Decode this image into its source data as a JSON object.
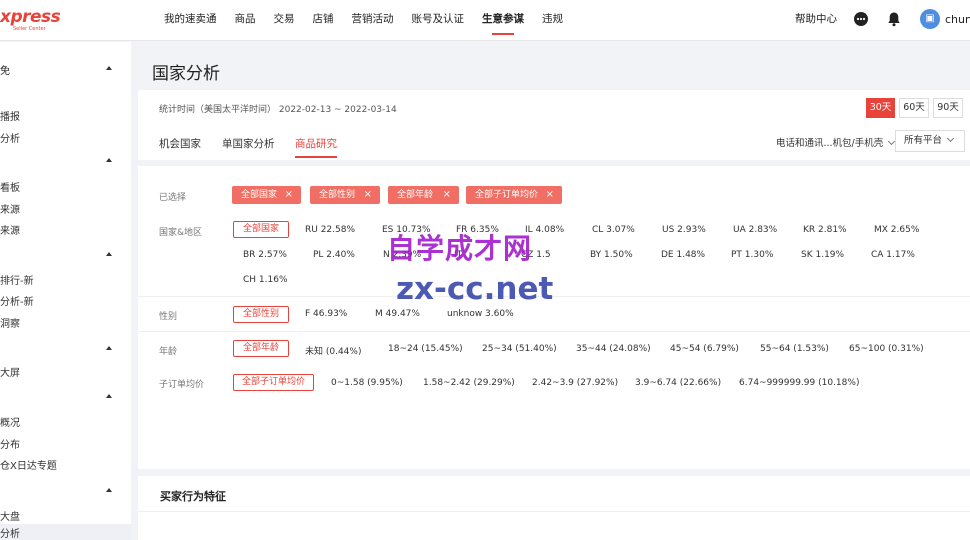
{
  "header": {
    "logo_main": "xpress",
    "logo_sub": "Seller Center",
    "nav": [
      "我的速卖通",
      "商品",
      "交易",
      "店铺",
      "营销活动",
      "账号及认证",
      "生意参谋",
      "违规"
    ],
    "active_nav": "生意参谋",
    "help": "帮助中心",
    "avatar_glyph": "▣",
    "username": "chun"
  },
  "sidebar": {
    "groups": [
      "免",
      "",
      "",
      "",
      "",
      ""
    ],
    "items": [
      "播报",
      "分析",
      "看板",
      "来源",
      "来源",
      "排行-新",
      "分析-新",
      "洞察",
      "大屏",
      "概况",
      "分布",
      "仓X日达专题",
      "大盘",
      "分析"
    ]
  },
  "page": {
    "title": "国家分析",
    "stat_label": "统计时间（美国太平洋时间）  2022-02-13 ~ 2022-03-14",
    "ranges": [
      "30天",
      "60天",
      "90天"
    ],
    "tabs": [
      "机会国家",
      "单国家分析",
      "商品研究"
    ],
    "category_select": "电话和通讯...机包/手机壳",
    "platform_select": "所有平台"
  },
  "filters": {
    "selected_label": "已选择",
    "chips": [
      "全部国家",
      "全部性别",
      "全部年龄",
      "全部子订单均价"
    ],
    "country_label": "国家&地区",
    "country_all": "全部国家",
    "countries_row1": [
      "RU  22.58%",
      "ES  10.73%",
      "FR  6.35%",
      "IL  4.08%",
      "CL  3.07%",
      "US  2.93%",
      "UA  2.83%",
      "KR  2.81%",
      "MX  2.65%"
    ],
    "countries_row2": [
      "BR  2.57%",
      "PL  2.40%",
      "N   2.39%",
      "IT",
      "CZ  1.5",
      "BY  1.50%",
      "DE  1.48%",
      "PT  1.30%",
      "SK  1.19%",
      "CA  1.17%"
    ],
    "countries_row3": [
      "CH  1.16%"
    ],
    "gender_label": "性别",
    "gender_all": "全部性别",
    "genders": [
      "F  46.93%",
      "M  49.47%",
      "unknow  3.60%"
    ],
    "age_label": "年龄",
    "age_all": "全部年龄",
    "ages": [
      "未知  (0.44%)",
      "18~24  (15.45%)",
      "25~34  (51.40%)",
      "35~44  (24.08%)",
      "45~54  (6.79%)",
      "55~64  (1.53%)",
      "65~100  (0.31%)"
    ],
    "price_label": "子订单均价",
    "price_all": "全部子订单均价",
    "prices": [
      "0~1.58  (9.95%)",
      "1.58~2.42  (29.29%)",
      "2.42~3.9  (27.92%)",
      "3.9~6.74  (22.66%)",
      "6.74~999999.99  (10.18%)"
    ]
  },
  "section2": {
    "title": "买家行为特征"
  },
  "watermark": {
    "line1": "自学成才网",
    "line2": "zx-cc.net"
  },
  "colors": {
    "accent": "#e8433b",
    "chip": "#f06e63",
    "watermark1": "#a21ccc",
    "watermark2": "#3949ab"
  }
}
